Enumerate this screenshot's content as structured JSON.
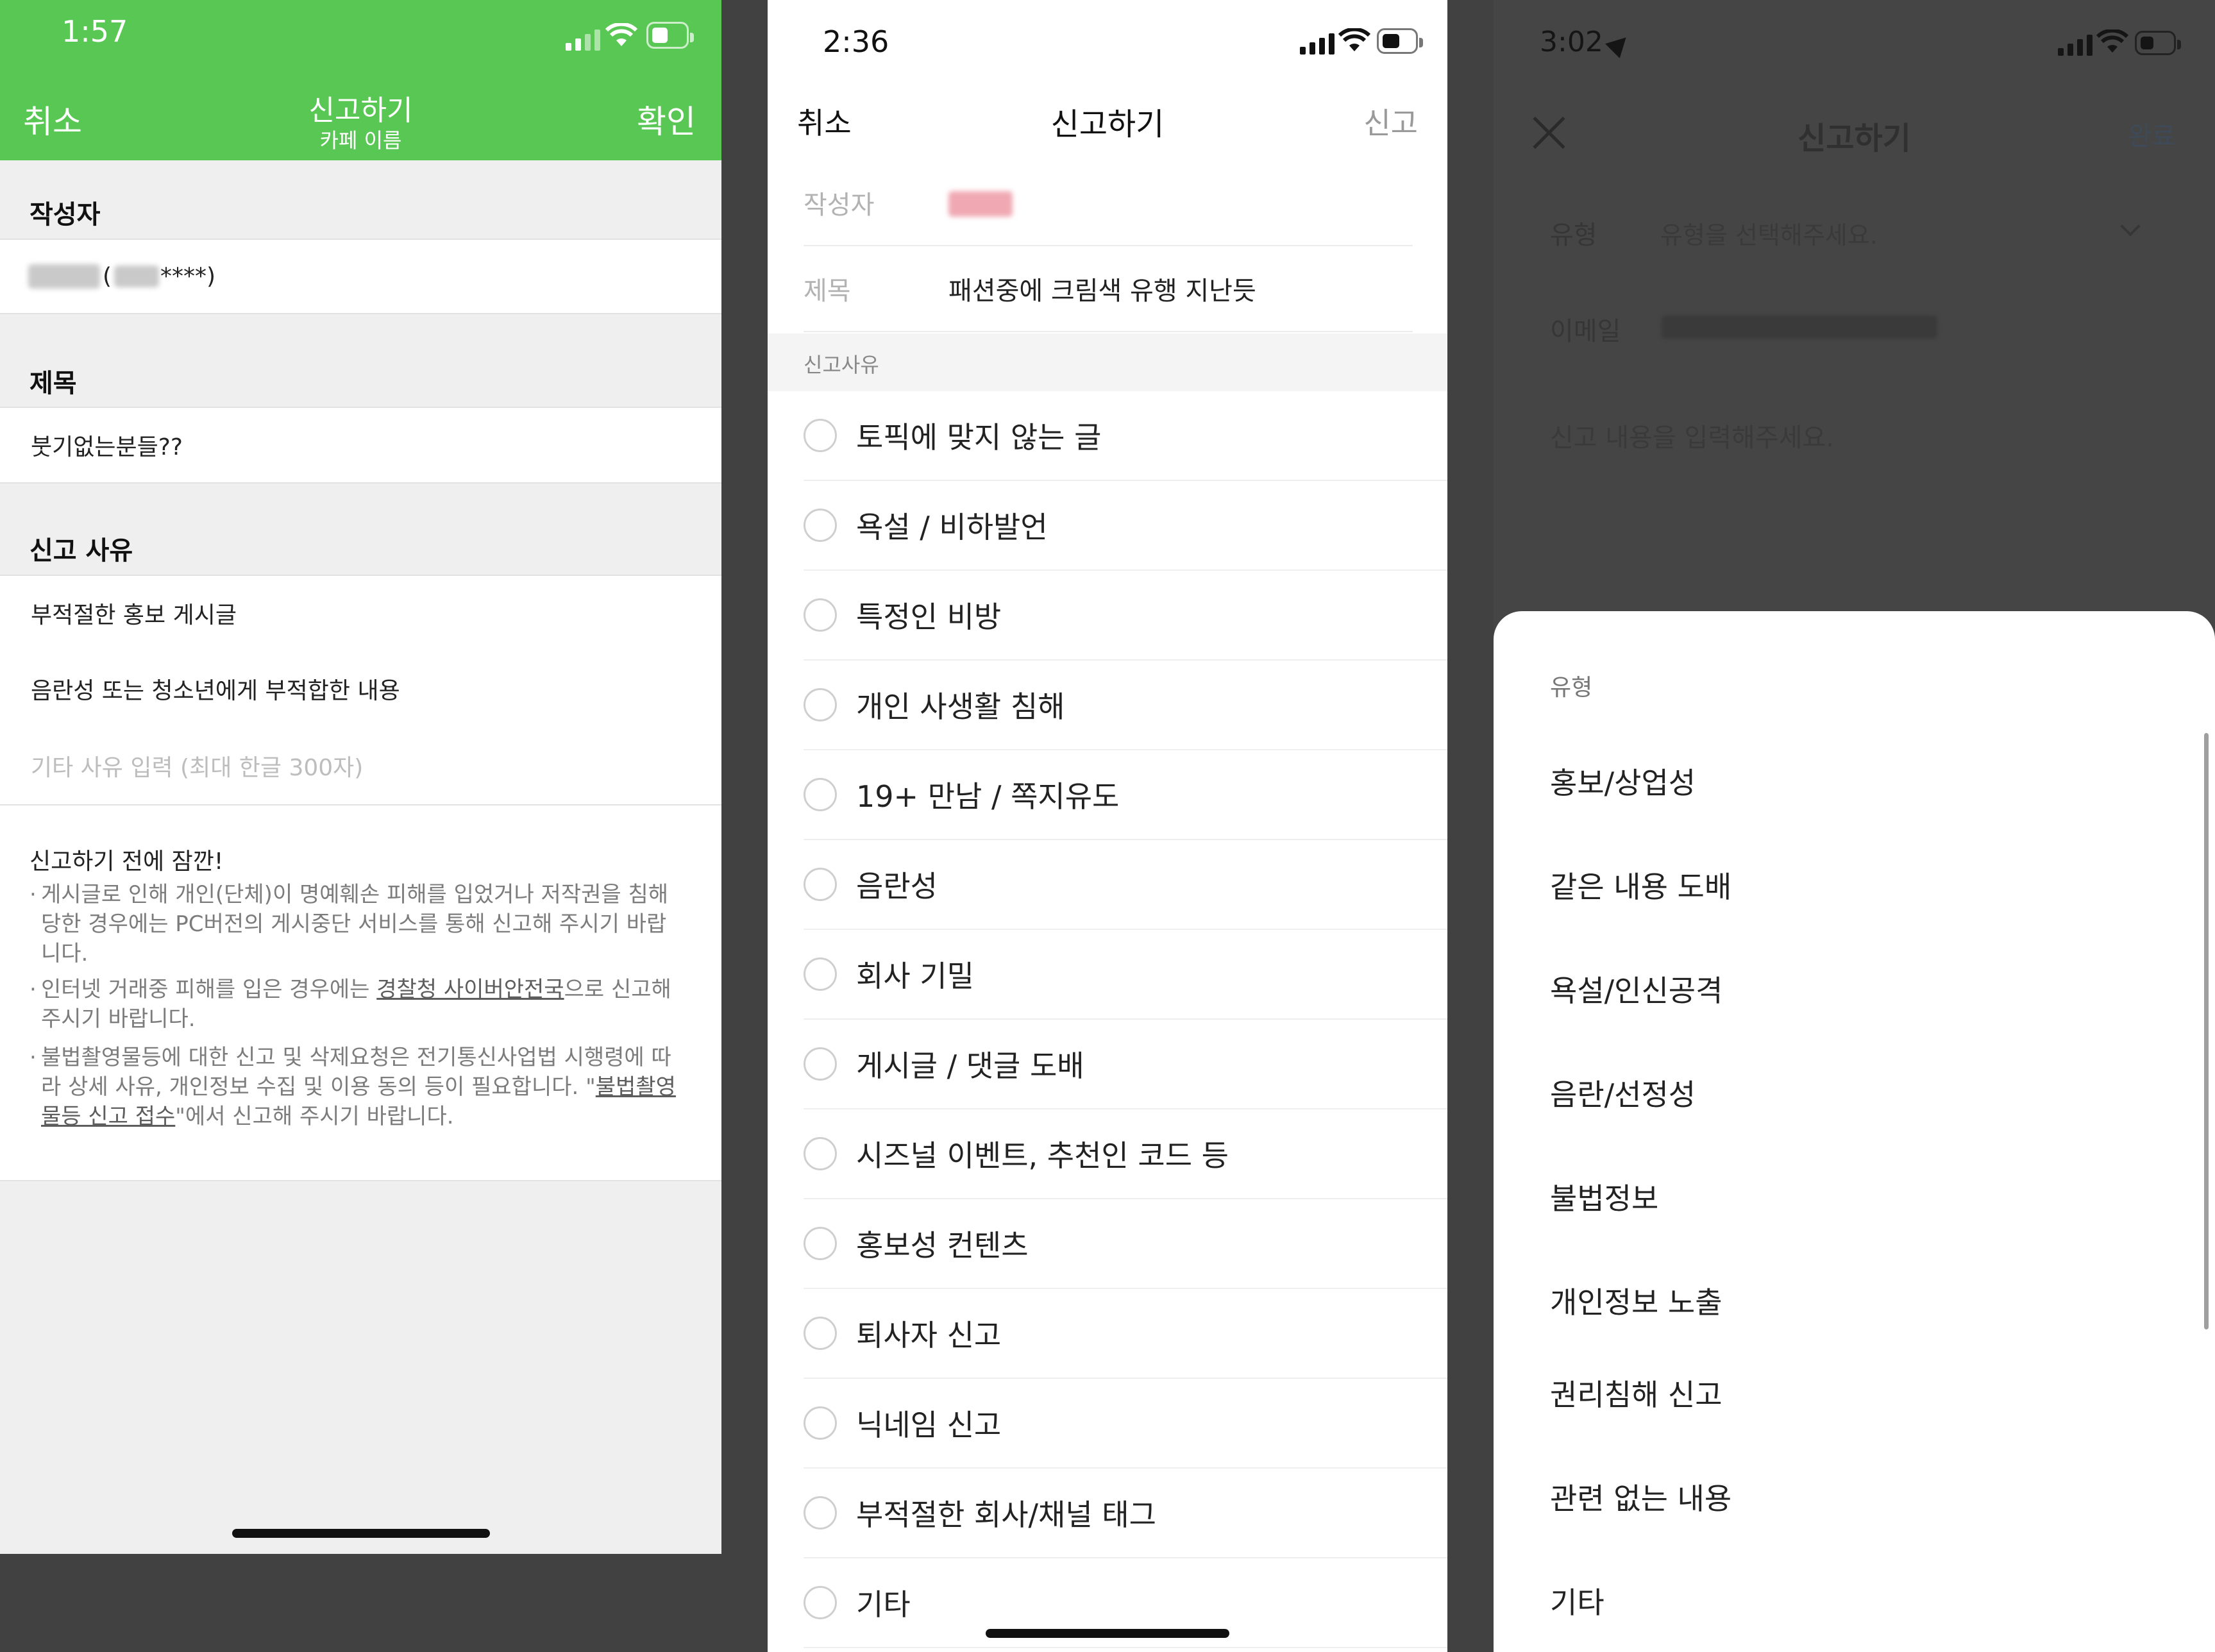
{
  "phone1": {
    "status_time": "1:57",
    "nav": {
      "cancel": "취소",
      "title": "신고하기",
      "subtitle": "카페 이름",
      "confirm": "확인"
    },
    "author": {
      "heading": "작성자",
      "value_suffix": "****)"
    },
    "subject": {
      "heading": "제목",
      "value": "붓기없는분들??"
    },
    "reason": {
      "heading": "신고 사유",
      "items": [
        "부적절한 홍보 게시글",
        "음란성 또는 청소년에게 부적합한 내용"
      ],
      "placeholder": "기타 사유 입력 (최대 한글 300자)"
    },
    "notice": {
      "title": "신고하기 전에 잠깐!",
      "bullet": "·",
      "item1": "게시글로 인해 개인(단체)이 명예훼손 피해를 입었거나 저작권을 침해 당한 경우에는 PC버전의 게시중단 서비스를 통해 신고해 주시기 바랍니다.",
      "item2_pre": "인터넷 거래중 피해를 입은 경우에는 ",
      "item2_link": "경찰청 사이버안전국",
      "item2_post": "으로 신고해 주시기 바랍니다.",
      "item3_pre": "불법촬영물등에 대한 신고 및 삭제요청은 전기통신사업법 시행령에 따라 상세 사유, 개인정보 수집 및 이용 동의 등이 필요합니다. \"",
      "item3_link": "불법촬영물등 신고 접수",
      "item3_post": "\"에서 신고해 주시기 바랍니다."
    }
  },
  "phone2": {
    "status_time": "2:36",
    "nav": {
      "cancel": "취소",
      "title": "신고하기",
      "report": "신고"
    },
    "author_label": "작성자",
    "subject_label": "제목",
    "subject_value": "패션중에 크림색 유행 지난듯",
    "reason_header": "신고사유",
    "options": [
      "토픽에 맞지 않는 글",
      "욕설 / 비하발언",
      "특정인 비방",
      "개인 사생활 침해",
      "19+ 만남 / 쪽지유도",
      "음란성",
      "회사 기밀",
      "게시글 / 댓글 도배",
      "시즈널 이벤트, 추천인 코드 등",
      "홍보성 컨텐츠",
      "퇴사자 신고",
      "닉네임 신고",
      "부적절한 회사/채널 태그",
      "기타"
    ]
  },
  "phone3": {
    "status_time": "3:02",
    "nav": {
      "title": "신고하기",
      "done": "완료"
    },
    "type_label": "유형",
    "type_placeholder": "유형을 선택해주세요.",
    "email_label": "이메일",
    "content_placeholder": "신고 내용을 입력해주세요.",
    "sheet": {
      "title": "유형",
      "items": [
        "홍보/상업성",
        "같은 내용 도배",
        "욕설/인신공격",
        "음란/선정성",
        "불법정보",
        "개인정보 노출",
        "권리침해 신고",
        "관련 없는 내용",
        "기타"
      ]
    }
  },
  "colors": {
    "green_header": "#59c753",
    "dim_overlay": "#454545",
    "background": "#414141"
  }
}
